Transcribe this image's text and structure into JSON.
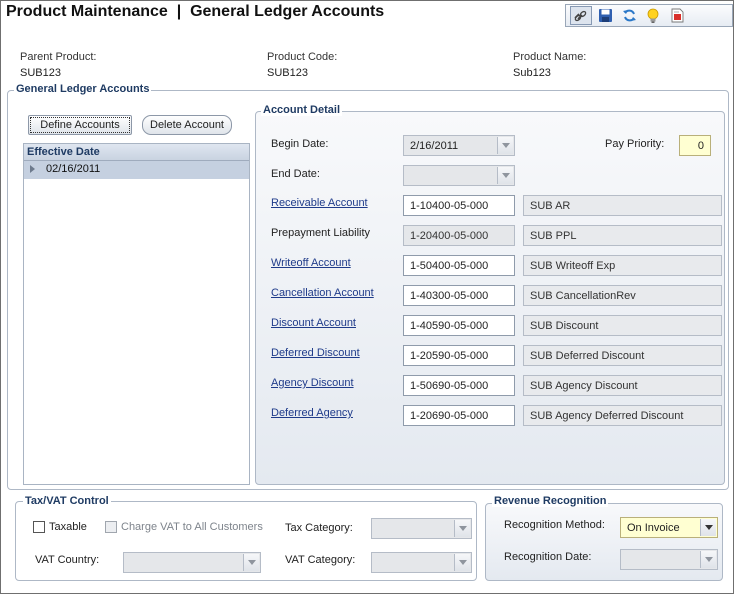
{
  "header": {
    "title": "Product Maintenance  |  General Ledger Accounts"
  },
  "toolbar": {
    "icons": [
      "link-icon",
      "save-icon",
      "refresh-icon",
      "lightbulb-icon",
      "report-icon"
    ]
  },
  "product_info": {
    "parent_label": "Parent Product:",
    "parent_value": "SUB123",
    "code_label": "Product Code:",
    "code_value": "SUB123",
    "name_label": "Product Name:",
    "name_value": "Sub123"
  },
  "gl_accounts": {
    "title": "General Ledger Accounts",
    "define_button": "Define Accounts",
    "delete_button": "Delete Account",
    "grid_header": "Effective Date",
    "rows": [
      "02/16/2011"
    ]
  },
  "account_detail": {
    "title": "Account Detail",
    "begin_date_label": "Begin Date:",
    "begin_date_value": "2/16/2011",
    "end_date_label": "End Date:",
    "end_date_value": "",
    "pay_priority_label": "Pay Priority:",
    "pay_priority_value": "0",
    "accounts": [
      {
        "label": "Receivable Account",
        "link": true,
        "code": "1-10400-05-000",
        "desc": "SUB AR",
        "editable": true
      },
      {
        "label": "Prepayment Liability",
        "link": false,
        "code": "1-20400-05-000",
        "desc": "SUB PPL",
        "editable": false
      },
      {
        "label": "Writeoff Account",
        "link": true,
        "code": "1-50400-05-000",
        "desc": "SUB Writeoff Exp",
        "editable": true
      },
      {
        "label": "Cancellation Account",
        "link": true,
        "code": "1-40300-05-000",
        "desc": "SUB CancellationRev",
        "editable": true
      },
      {
        "label": "Discount Account",
        "link": true,
        "code": "1-40590-05-000",
        "desc": "SUB Discount",
        "editable": true
      },
      {
        "label": "Deferred Discount",
        "link": true,
        "code": "1-20590-05-000",
        "desc": "SUB Deferred Discount",
        "editable": true
      },
      {
        "label": "Agency Discount",
        "link": true,
        "code": "1-50690-05-000",
        "desc": "SUB Agency Discount",
        "editable": true
      },
      {
        "label": "Deferred Agency",
        "link": true,
        "code": "1-20690-05-000",
        "desc": "SUB Agency Deferred Discount",
        "editable": true
      }
    ]
  },
  "tax_vat": {
    "title": "Tax/VAT Control",
    "taxable_label": "Taxable",
    "charge_vat_label": "Charge VAT to All Customers",
    "tax_category_label": "Tax Category:",
    "tax_category_value": "",
    "vat_country_label": "VAT Country:",
    "vat_country_value": "",
    "vat_category_label": "VAT Category:",
    "vat_category_value": ""
  },
  "revenue": {
    "title": "Revenue Recognition",
    "method_label": "Recognition Method:",
    "method_value": "On Invoice",
    "date_label": "Recognition Date:",
    "date_value": ""
  }
}
